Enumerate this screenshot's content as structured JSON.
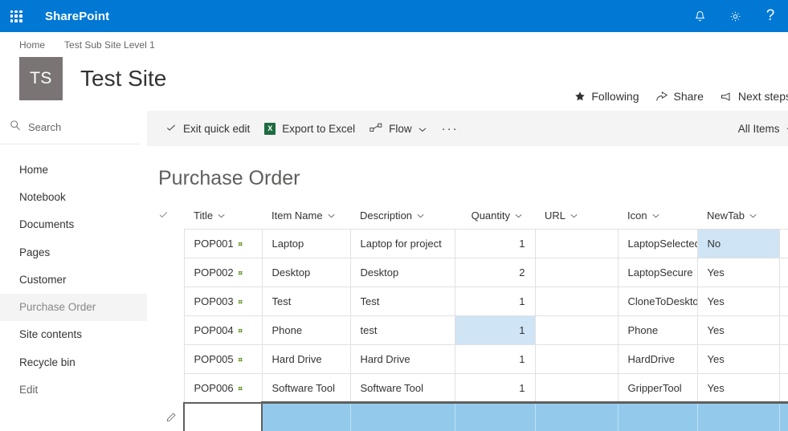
{
  "suite": {
    "brand": "SharePoint",
    "waffle_icon": "app-launcher-icon",
    "notifications_icon": "bell-icon",
    "settings_icon": "gear-icon",
    "help_icon": "question-mark-icon",
    "help_label": "?"
  },
  "site": {
    "breadcrumb": [
      "Home",
      "Test Sub Site Level 1"
    ],
    "logo_initials": "TS",
    "title": "Test Site",
    "actions": [
      {
        "label": "Following",
        "icon": "star-icon"
      },
      {
        "label": "Share",
        "icon": "share-icon"
      },
      {
        "label": "Next steps",
        "icon": "megaphone-icon"
      }
    ]
  },
  "sidebar": {
    "search": {
      "placeholder": "Search",
      "icon": "search-icon",
      "value": ""
    },
    "items": [
      {
        "label": "Home"
      },
      {
        "label": "Notebook"
      },
      {
        "label": "Documents"
      },
      {
        "label": "Pages"
      },
      {
        "label": "Customer"
      },
      {
        "label": "Purchase Order"
      },
      {
        "label": "Site contents"
      },
      {
        "label": "Recycle bin"
      },
      {
        "label": "Edit"
      }
    ],
    "selected_index": 5
  },
  "command_bar": {
    "exit_quick_edit": "Exit quick edit",
    "export_to_excel": "Export to Excel",
    "excel_glyph": "X",
    "flow": "Flow",
    "ellipsis": "···",
    "view_name": "All Items"
  },
  "list": {
    "title": "Purchase Order",
    "add_column_label": "+",
    "columns": [
      {
        "key": "title",
        "label": "Title"
      },
      {
        "key": "item_name",
        "label": "Item Name"
      },
      {
        "key": "description",
        "label": "Description"
      },
      {
        "key": "quantity",
        "label": "Quantity"
      },
      {
        "key": "url",
        "label": "URL"
      },
      {
        "key": "icon",
        "label": "Icon"
      },
      {
        "key": "newtab",
        "label": "NewTab"
      }
    ],
    "new_badge": "⌗",
    "rows": [
      {
        "title": "POP001",
        "item_name": "Laptop",
        "description": "Laptop for project",
        "quantity": "1",
        "url": "",
        "icon": "LaptopSelected",
        "newtab": "No"
      },
      {
        "title": "POP002",
        "item_name": "Desktop",
        "description": "Desktop",
        "quantity": "2",
        "url": "",
        "icon": "LaptopSecure",
        "newtab": "Yes"
      },
      {
        "title": "POP003",
        "item_name": "Test",
        "description": "Test",
        "quantity": "1",
        "url": "",
        "icon": "CloneToDesktop",
        "newtab": "Yes"
      },
      {
        "title": "POP004",
        "item_name": "Phone",
        "description": "test",
        "quantity": "1",
        "url": "",
        "icon": "Phone",
        "newtab": "Yes"
      },
      {
        "title": "POP005",
        "item_name": "Hard Drive",
        "description": "Hard Drive",
        "quantity": "1",
        "url": "",
        "icon": "HardDrive",
        "newtab": "Yes"
      },
      {
        "title": "POP006",
        "item_name": "Software Tool",
        "description": "Software Tool",
        "quantity": "1",
        "url": "",
        "icon": "GripperTool",
        "newtab": "Yes"
      }
    ],
    "highlighted_cells": [
      {
        "row": 0,
        "column": "newtab"
      },
      {
        "row": 3,
        "column": "quantity"
      }
    ],
    "new_item_row": {
      "edit_icon": "pencil-icon",
      "title_value": "",
      "active_column": "title"
    }
  },
  "colors": {
    "suite_bar": "#0078d4",
    "command_bar": "#f4f4f4",
    "site_logo": "#7a7574",
    "cell_highlight": "#cfe4f5",
    "new_row_fill": "#93caeb",
    "new_badge": "#498205"
  }
}
